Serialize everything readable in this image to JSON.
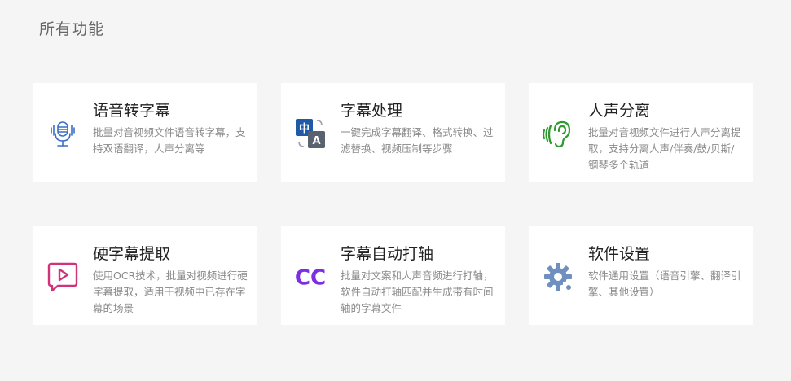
{
  "page": {
    "title": "所有功能"
  },
  "cards": [
    {
      "title": "语音转字幕",
      "desc": "批量对音视频文件语音转字幕，支持双语翻译，人声分离等",
      "icon": "microphone-icon"
    },
    {
      "title": "字幕处理",
      "desc": "一键完成字幕翻译、格式转换、过滤替换、视频压制等步骤",
      "icon": "translate-icon",
      "icon_text": [
        "中",
        "A"
      ]
    },
    {
      "title": "人声分离",
      "desc": "批量对音视频文件进行人声分离提取，支持分离人声/伴奏/鼓/贝斯/钢琴多个轨道",
      "icon": "ear-icon"
    },
    {
      "title": "硬字幕提取",
      "desc": "使用OCR技术，批量对视频进行硬字幕提取，适用于视频中已存在字幕的场景",
      "icon": "video-subtitle-icon"
    },
    {
      "title": "字幕自动打轴",
      "desc": "批量对文案和人声音频进行打轴，软件自动打轴匹配并生成带有时间轴的字幕文件",
      "icon": "cc-icon",
      "icon_text": [
        "CC"
      ]
    },
    {
      "title": "软件设置",
      "desc": "软件通用设置（语音引擎、翻译引擎、其他设置）",
      "icon": "gear-icon"
    }
  ],
  "colors": {
    "background": "#f5f5f5",
    "card": "#ffffff",
    "title": "#222222",
    "desc": "#8a8a8a",
    "mic": "#3a6fc4",
    "translate_blue": "#1f5aa6",
    "translate_gray": "#5a6270",
    "ear": "#2e9a2e",
    "video_pink": "#d0337a",
    "cc_purple": "#7b2fe0",
    "gear": "#6f8fbf"
  }
}
